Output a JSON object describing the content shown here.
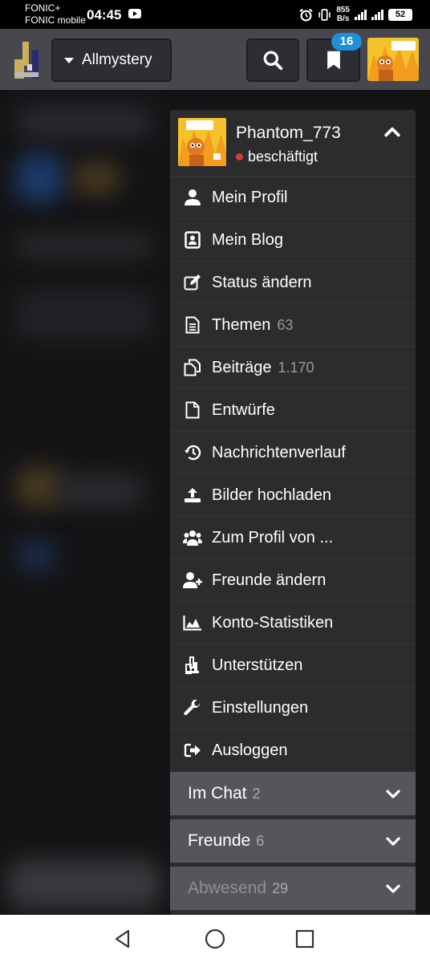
{
  "statusbar": {
    "carrier_line1": "FONIC+",
    "carrier_line2": "FONIC mobile",
    "time": "04:45",
    "net_speed_value": "855",
    "net_speed_unit": "B/s",
    "battery": "52"
  },
  "header": {
    "site_name": "Allmystery",
    "bookmark_badge": "16"
  },
  "menu": {
    "username": "Phantom_773",
    "status": "beschäftigt",
    "items": [
      {
        "label": "Mein Profil",
        "count": "",
        "icon": "user-icon"
      },
      {
        "label": "Mein Blog",
        "count": "",
        "icon": "blog-icon"
      },
      {
        "label": "Status ändern",
        "count": "",
        "icon": "edit-icon"
      },
      {
        "label": "Themen",
        "count": "63",
        "icon": "document-lines-icon"
      },
      {
        "label": "Beiträge",
        "count": "1.170",
        "icon": "copy-icon"
      },
      {
        "label": "Entwürfe",
        "count": "",
        "icon": "file-icon"
      },
      {
        "label": "Nachrichtenverlauf",
        "count": "",
        "icon": "history-icon"
      },
      {
        "label": "Bilder hochladen",
        "count": "",
        "icon": "upload-icon"
      },
      {
        "label": "Zum Profil von ...",
        "count": "",
        "icon": "users-icon"
      },
      {
        "label": "Freunde ändern",
        "count": "",
        "icon": "user-plus-icon"
      },
      {
        "label": "Konto-Statistiken",
        "count": "",
        "icon": "area-chart-icon"
      },
      {
        "label": "Unterstützen",
        "count": "",
        "icon": "support-logo-icon"
      },
      {
        "label": "Einstellungen",
        "count": "",
        "icon": "wrench-icon"
      },
      {
        "label": "Ausloggen",
        "count": "",
        "icon": "logout-icon"
      }
    ],
    "sections": [
      {
        "label": "Im Chat",
        "count": "2"
      },
      {
        "label": "Freunde",
        "count": "6"
      },
      {
        "label": "Abwesend",
        "count": "29"
      }
    ]
  },
  "colors": {
    "header_bg": "#47484e",
    "menu_bg": "#2c2c2e",
    "section_bg": "#55555b",
    "badge": "#1e8fd8",
    "status_busy": "#d23b3b"
  }
}
